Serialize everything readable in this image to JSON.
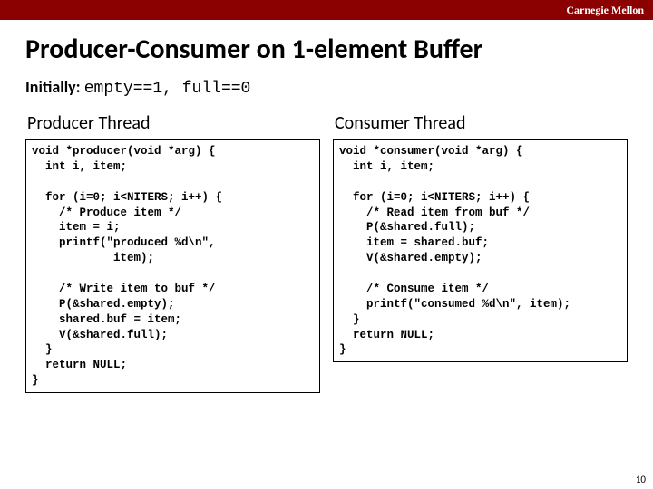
{
  "header": {
    "brand": "Carnegie Mellon"
  },
  "title": "Producer-Consumer on 1-element Buffer",
  "initially": {
    "label": "Initially:",
    "expr": "empty==1, full==0"
  },
  "producer": {
    "heading": "Producer Thread",
    "code": "void *producer(void *arg) {\n  int i, item;\n\n  for (i=0; i<NITERS; i++) {\n    /* Produce item */\n    item = i;\n    printf(\"produced %d\\n\",\n            item);\n\n    /* Write item to buf */\n    P(&shared.empty);\n    shared.buf = item;\n    V(&shared.full);\n  }\n  return NULL;\n}"
  },
  "consumer": {
    "heading": "Consumer Thread",
    "code": "void *consumer(void *arg) {\n  int i, item;\n\n  for (i=0; i<NITERS; i++) {\n    /* Read item from buf */\n    P(&shared.full);\n    item = shared.buf;\n    V(&shared.empty);\n\n    /* Consume item */\n    printf(\"consumed %d\\n\", item);\n  }\n  return NULL;\n}"
  },
  "page_number": "10"
}
